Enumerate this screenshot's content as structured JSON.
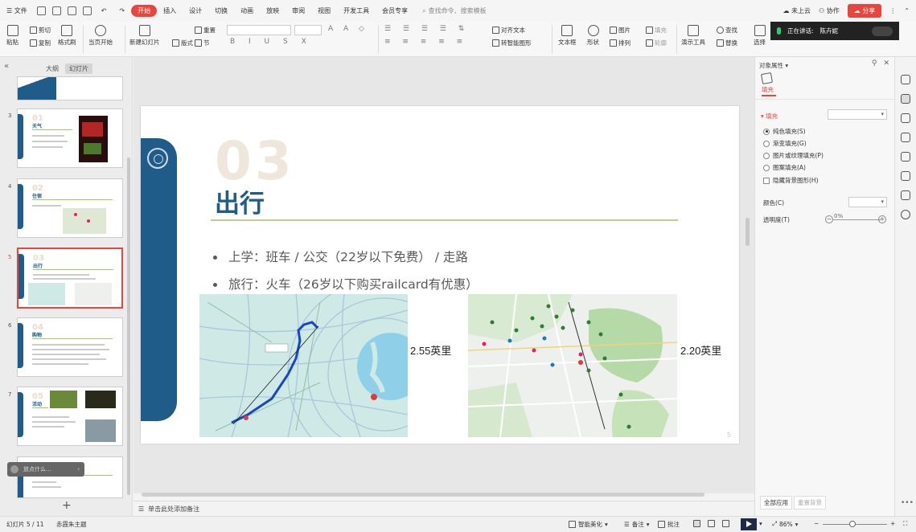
{
  "menubar": {
    "file": "文件",
    "tabs": [
      "开始",
      "插入",
      "设计",
      "切换",
      "动画",
      "放映",
      "审阅",
      "视图",
      "开发工具",
      "会员专享"
    ],
    "active_tab": "开始",
    "search_placeholder": "查找命令、搜索模板",
    "cloud": "未上云",
    "collab": "协作",
    "share": "分享"
  },
  "ribbon": {
    "paste": "粘贴",
    "cut": "剪切",
    "copy": "复制",
    "format_painter": "格式刷",
    "from_current": "当页开始",
    "new_slide": "新建幻灯片",
    "layout": "版式",
    "section": "节",
    "reset": "重置",
    "align_text": "对齐文本",
    "smartart": "转智能图形",
    "textbox": "文本框",
    "shape": "形状",
    "picture": "图片",
    "fill": "填充",
    "arrange": "排列",
    "outline": "轮廓",
    "present_tool": "演示工具",
    "find": "查找",
    "replace": "替换",
    "select": "选择",
    "speaking_label": "正在讲话:",
    "speaking_name": "陈卉妮"
  },
  "leftpanel": {
    "tab_outline": "大纲",
    "tab_slides": "幻灯片",
    "pill_text": "放点什么...",
    "add": "+",
    "slides": [
      {
        "num": "3",
        "tnum": "01",
        "title": "天气"
      },
      {
        "num": "4",
        "tnum": "02",
        "title": "住宿"
      },
      {
        "num": "5",
        "tnum": "03",
        "title": "出行"
      },
      {
        "num": "6",
        "tnum": "04",
        "title": "购物"
      },
      {
        "num": "7",
        "tnum": "05",
        "title": "活动"
      }
    ]
  },
  "slide": {
    "number": "03",
    "title": "出行",
    "bullets": [
      "上学：班车 / 公交（22岁以下免费） / 走路",
      "旅行：火车（26岁以下购买railcard有优惠）"
    ],
    "distance1": "2.55英里",
    "distance2": "2.20英里",
    "page": "5"
  },
  "notes_placeholder": "单击此处添加备注",
  "rightpanel": {
    "title": "对象属性",
    "fill_tab": "填充",
    "fill_section": "填充",
    "options": [
      "纯色填充(S)",
      "渐变填充(G)",
      "图片或纹理填充(P)",
      "图案填充(A)"
    ],
    "selected_option": "纯色填充(S)",
    "hide_bg": "隐藏背景图形(H)",
    "color_label": "颜色(C)",
    "transparency_label": "透明度(T)",
    "transparency_value": "0%",
    "apply_all": "全部应用",
    "reset_bg": "重置背景"
  },
  "statusbar": {
    "slide_info": "幻灯片 5 / 11",
    "theme": "赤霞朱主题",
    "smart": "智能美化",
    "notes": "备注",
    "comments": "批注",
    "zoom": "86%"
  },
  "colors": {
    "accent": "#e8453c",
    "slide_blue": "#1f5c89",
    "slide_green_rule": "#b7d48a"
  }
}
